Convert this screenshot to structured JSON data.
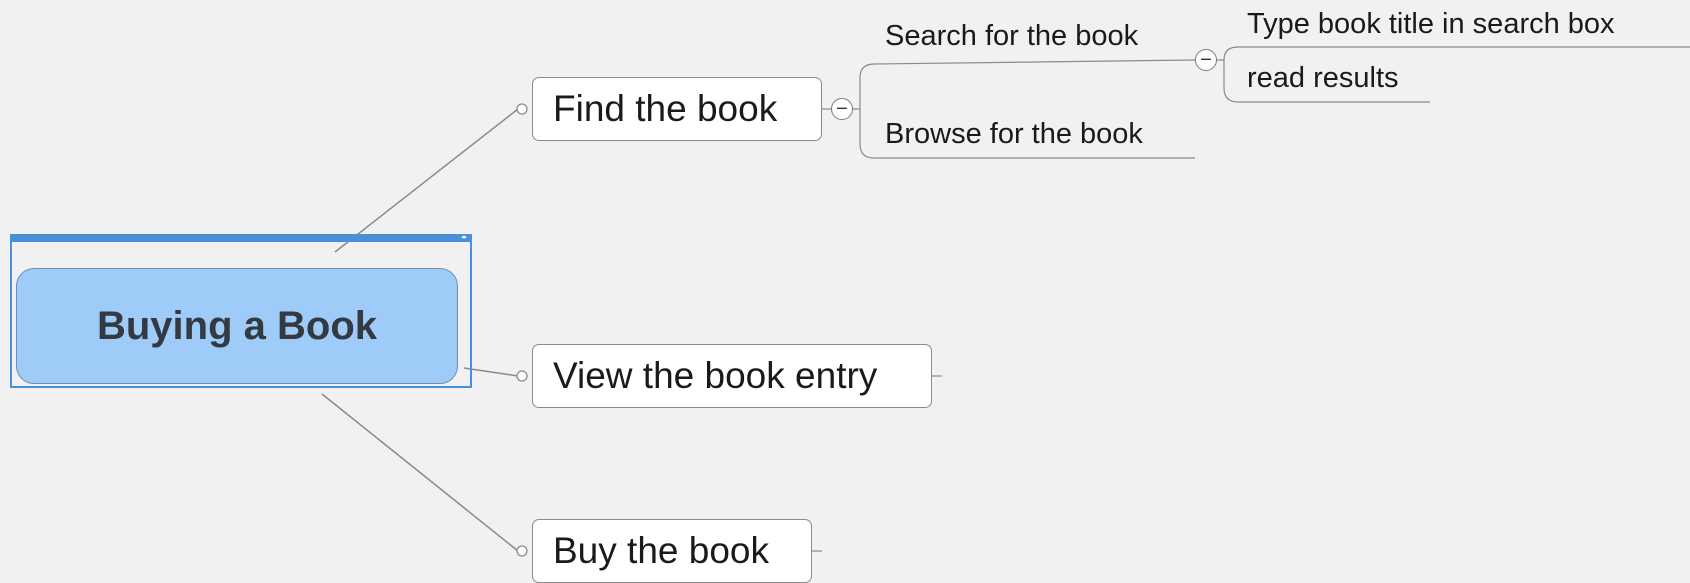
{
  "central_topic": {
    "label": "Buying a Book"
  },
  "topics": {
    "find": {
      "label": "Find the book"
    },
    "view": {
      "label": "View the book entry"
    },
    "buy": {
      "label": "Buy the book"
    }
  },
  "subtopics": {
    "search": {
      "label": "Search for the book"
    },
    "browse": {
      "label": "Browse for the book"
    },
    "type": {
      "label": "Type book title in search box"
    },
    "read": {
      "label": "read results"
    }
  },
  "controls": {
    "collapse_symbol": "−"
  },
  "colors": {
    "canvas": "#f1f1f1",
    "central_fill": "#9ecbf8",
    "selection": "#4a90d9",
    "connector": "#8a8a8a",
    "text": "#1a1a1a"
  }
}
